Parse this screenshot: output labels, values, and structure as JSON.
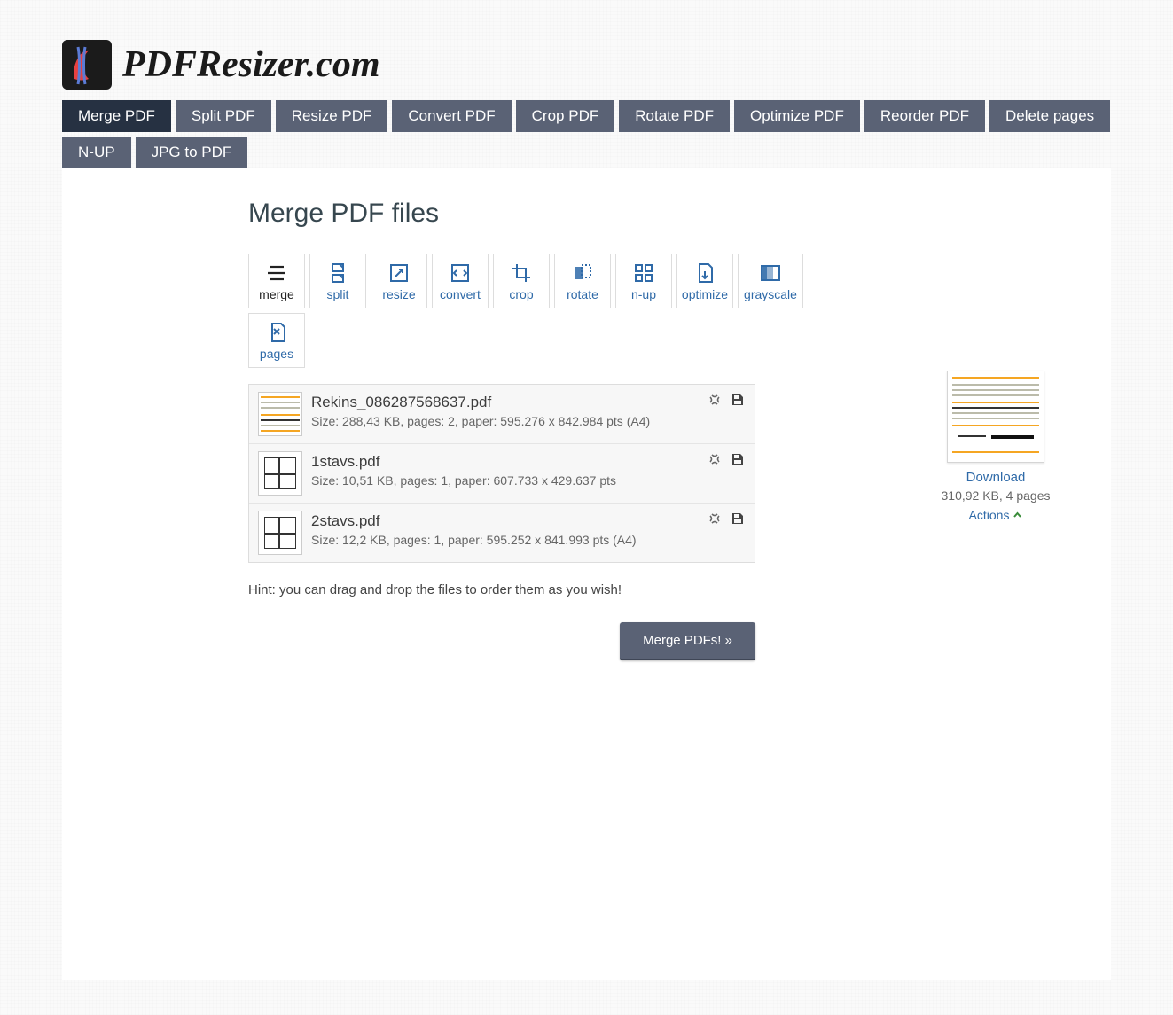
{
  "brand": "PDFResizer.com",
  "nav": {
    "items": [
      {
        "label": "Merge PDF",
        "active": true
      },
      {
        "label": "Split PDF"
      },
      {
        "label": "Resize PDF"
      },
      {
        "label": "Convert PDF"
      },
      {
        "label": "Crop PDF"
      },
      {
        "label": "Rotate PDF"
      },
      {
        "label": "Optimize PDF"
      },
      {
        "label": "Reorder PDF"
      },
      {
        "label": "Delete pages"
      },
      {
        "label": "N-UP"
      },
      {
        "label": "JPG to PDF"
      }
    ]
  },
  "page": {
    "title": "Merge PDF files",
    "hint": "Hint: you can drag and drop the files to order them as you wish!",
    "merge_button": "Merge PDFs! »"
  },
  "toolbar": [
    {
      "label": "merge",
      "active": true
    },
    {
      "label": "split"
    },
    {
      "label": "resize"
    },
    {
      "label": "convert"
    },
    {
      "label": "crop"
    },
    {
      "label": "rotate"
    },
    {
      "label": "n-up"
    },
    {
      "label": "optimize"
    },
    {
      "label": "grayscale",
      "wide": true
    },
    {
      "label": "pages"
    }
  ],
  "files": [
    {
      "name": "Rekins_086287568637.pdf",
      "meta": "Size: 288,43 KB, pages: 2, paper: 595.276 x 842.984 pts (A4)"
    },
    {
      "name": "1stavs.pdf",
      "meta": "Size: 10,51 KB, pages: 1, paper: 607.733 x 429.637 pts"
    },
    {
      "name": "2stavs.pdf",
      "meta": "Size: 12,2 KB, pages: 1, paper: 595.252 x 841.993 pts (A4)"
    }
  ],
  "result": {
    "download_label": "Download",
    "meta": "310,92 KB, 4 pages",
    "actions_label": "Actions"
  }
}
